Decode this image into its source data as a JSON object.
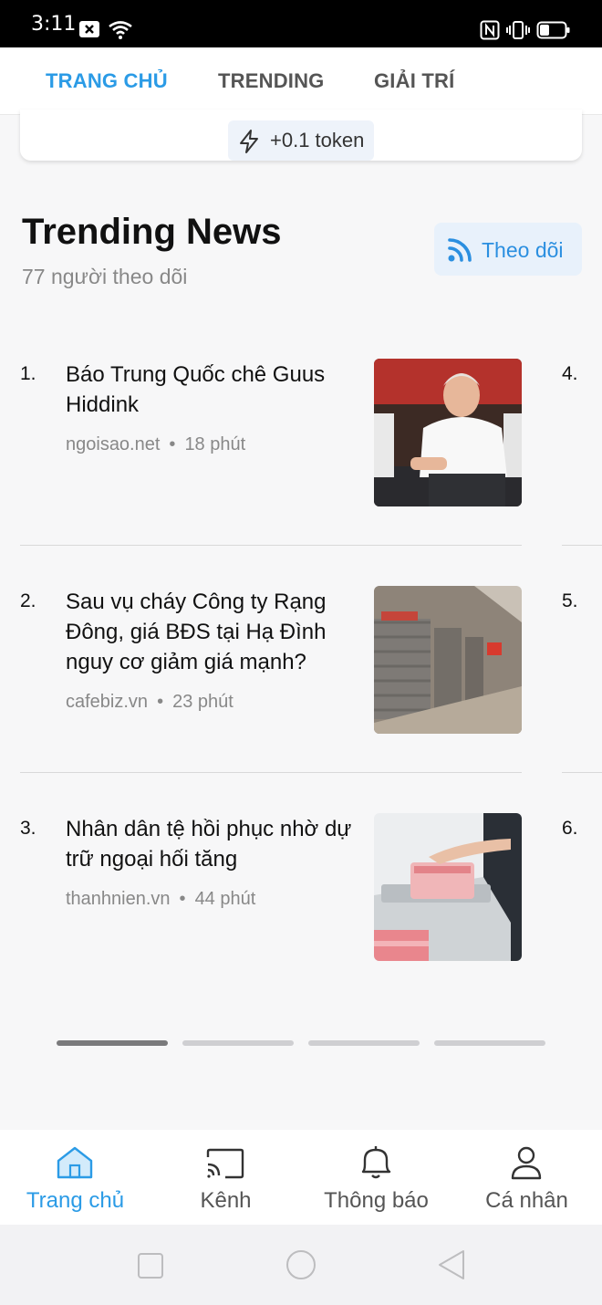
{
  "status_bar": {
    "time": "3:11"
  },
  "tabs": [
    {
      "label": "TRANG CHỦ",
      "active": true
    },
    {
      "label": "TRENDING",
      "active": false
    },
    {
      "label": "GIẢI TRÍ",
      "active": false
    }
  ],
  "token": {
    "label": "+0.1 token"
  },
  "section": {
    "title": "Trending News",
    "followers": "77 người theo dõi",
    "follow_label": "Theo dõi"
  },
  "items": [
    {
      "num": "1.",
      "title": "Báo Trung Quốc chê Guus Hiddink",
      "source": "ngoisao.net",
      "dot": "•",
      "time": "18 phút",
      "right_num": "4."
    },
    {
      "num": "2.",
      "title": "Sau vụ cháy Công ty Rạng Đông, giá BĐS tại Hạ Đình nguy cơ giảm giá mạnh?",
      "source": "cafebiz.vn",
      "dot": "•",
      "time": "23 phút",
      "right_num": "5."
    },
    {
      "num": "3.",
      "title": "Nhân dân tệ hồi phục nhờ dự trữ ngoại hối tăng",
      "source": "thanhnien.vn",
      "dot": "•",
      "time": "44 phút",
      "right_num": "6."
    }
  ],
  "pager": {
    "count": 4,
    "active_index": 0
  },
  "bottom_nav": [
    {
      "label": "Trang chủ",
      "icon": "home-icon",
      "active": true
    },
    {
      "label": "Kênh",
      "icon": "cast-icon",
      "active": false
    },
    {
      "label": "Thông báo",
      "icon": "bell-icon",
      "active": false
    },
    {
      "label": "Cá nhân",
      "icon": "person-icon",
      "active": false
    }
  ],
  "colors": {
    "accent": "#2b9be6",
    "muted": "#888888"
  }
}
